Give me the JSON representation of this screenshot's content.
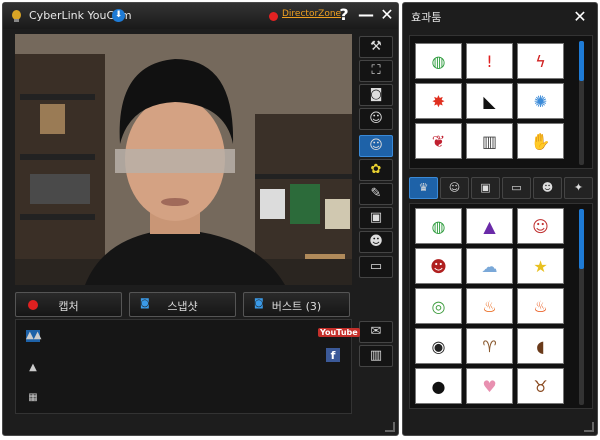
{
  "main_window": {
    "title": "CyberLink YouCam",
    "director_zone": "DirectorZone",
    "help_label": "?",
    "minimize_label": "—",
    "close_label": "✕"
  },
  "side_buttons": [
    {
      "name": "settings-button",
      "icon": "wrench-icon",
      "glyph": "⚙"
    },
    {
      "name": "fullscreen-button",
      "icon": "fullscreen-icon",
      "glyph": "⛶"
    },
    {
      "name": "surveillance-button",
      "icon": "camera-cctv-icon",
      "glyph": "◉"
    },
    {
      "name": "avatar-add-button",
      "icon": "avatar-plus-icon",
      "glyph": "☺"
    },
    {
      "name": "effects-button",
      "icon": "avatar-effect-icon",
      "glyph": "☺"
    },
    {
      "name": "particle-button",
      "icon": "flower-icon",
      "glyph": "✿"
    },
    {
      "name": "brush-button",
      "icon": "pencil-icon",
      "glyph": "✎"
    },
    {
      "name": "frame-button",
      "icon": "frame-plus-icon",
      "glyph": "▣"
    },
    {
      "name": "face-add-button",
      "icon": "face-plus-icon",
      "glyph": "☻"
    },
    {
      "name": "eraser-button",
      "icon": "eraser-icon",
      "glyph": "▭"
    },
    {
      "name": "email-button",
      "icon": "envelope-icon",
      "glyph": "✉"
    },
    {
      "name": "delete-button",
      "icon": "trash-icon",
      "glyph": "🗑"
    }
  ],
  "capture_buttons": {
    "capture": "캡처",
    "snapshot": "스냅샷",
    "burst": "버스트 (3)"
  },
  "gallery": {
    "youtube_label": "YouTube",
    "facebook_label": "f"
  },
  "effects_panel": {
    "title": "효과툼",
    "close_label": "✕",
    "top_items": [
      "globe-arrow",
      "exclamation-burst",
      "zigzag-lightning",
      "bam-comic",
      "crow",
      "confetti",
      "lips-pattern",
      "static-lines",
      "thumbs-up"
    ],
    "tabs": [
      "hat",
      "avatar",
      "frame",
      "screen",
      "face",
      "sparkle"
    ],
    "bottom_items": [
      "globe-arrow",
      "witch-hat",
      "cartoon-face",
      "opera-mask",
      "cloud",
      "stars",
      "goggles-crocodile",
      "flames",
      "flames-2",
      "gas-mask",
      "deer-ears",
      "dog-ears",
      "panda",
      "rabbit",
      "reindeer"
    ]
  }
}
